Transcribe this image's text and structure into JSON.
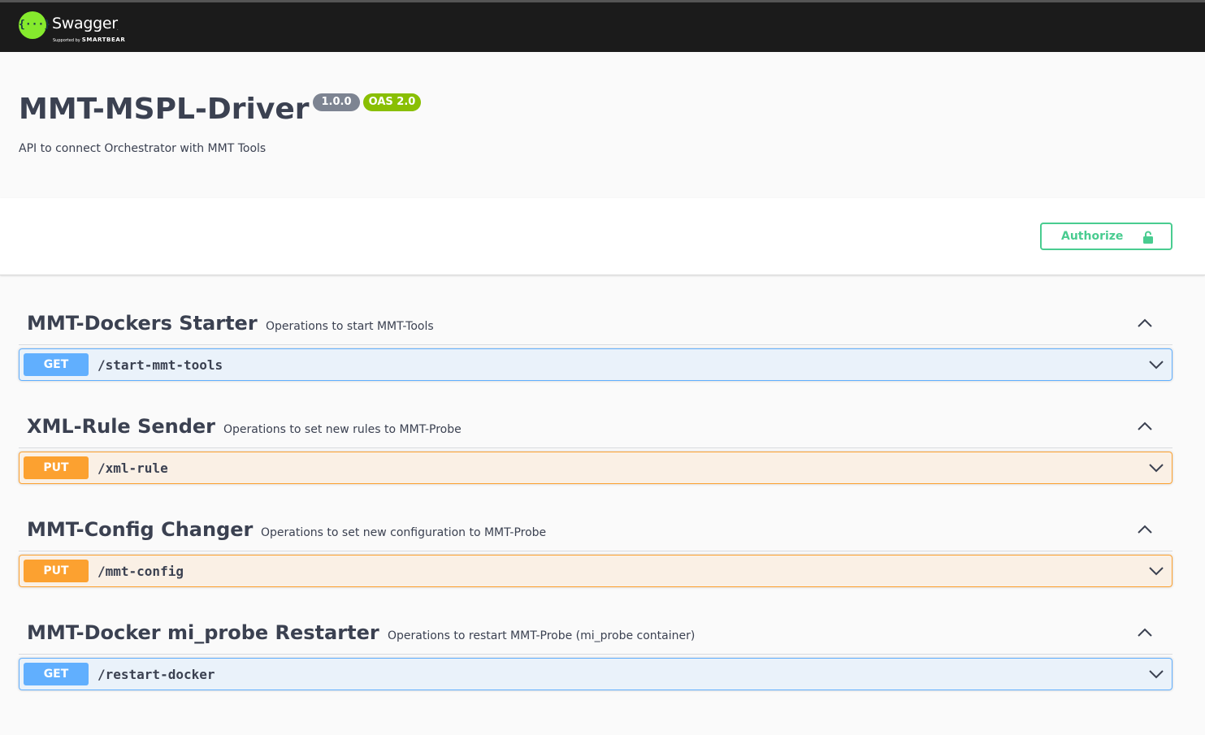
{
  "topbar": {
    "logo_glyph": "{···}",
    "brand": "Swagger",
    "tm": ".",
    "supported_by": "Supported by",
    "smartbear": "SMARTBEAR"
  },
  "info": {
    "title": "MMT-MSPL-Driver",
    "version": "1.0.0",
    "oas": "OAS 2.0",
    "description": "API to connect Orchestrator with MMT Tools"
  },
  "auth": {
    "label": "Authorize",
    "icon": "unlocked-lock-icon",
    "color": "#49cc90"
  },
  "colors": {
    "get": "#61affe",
    "put": "#fca130",
    "version_badge": "#7d8492",
    "oas_badge": "#89bf04"
  },
  "tags": [
    {
      "name": "MMT-Dockers Starter",
      "description": "Operations to start MMT-Tools",
      "expanded": true,
      "operation": {
        "method": "GET",
        "path": "/start-mmt-tools"
      }
    },
    {
      "name": "XML-Rule Sender",
      "description": "Operations to set new rules to MMT-Probe",
      "expanded": true,
      "operation": {
        "method": "PUT",
        "path": "/xml-rule"
      }
    },
    {
      "name": "MMT-Config Changer",
      "description": "Operations to set new configuration to MMT-Probe",
      "expanded": true,
      "operation": {
        "method": "PUT",
        "path": "/mmt-config"
      }
    },
    {
      "name": "MMT-Docker mi_probe Restarter",
      "description": "Operations to restart MMT-Probe (mi_probe container)",
      "expanded": true,
      "operation": {
        "method": "GET",
        "path": "/restart-docker"
      }
    }
  ]
}
